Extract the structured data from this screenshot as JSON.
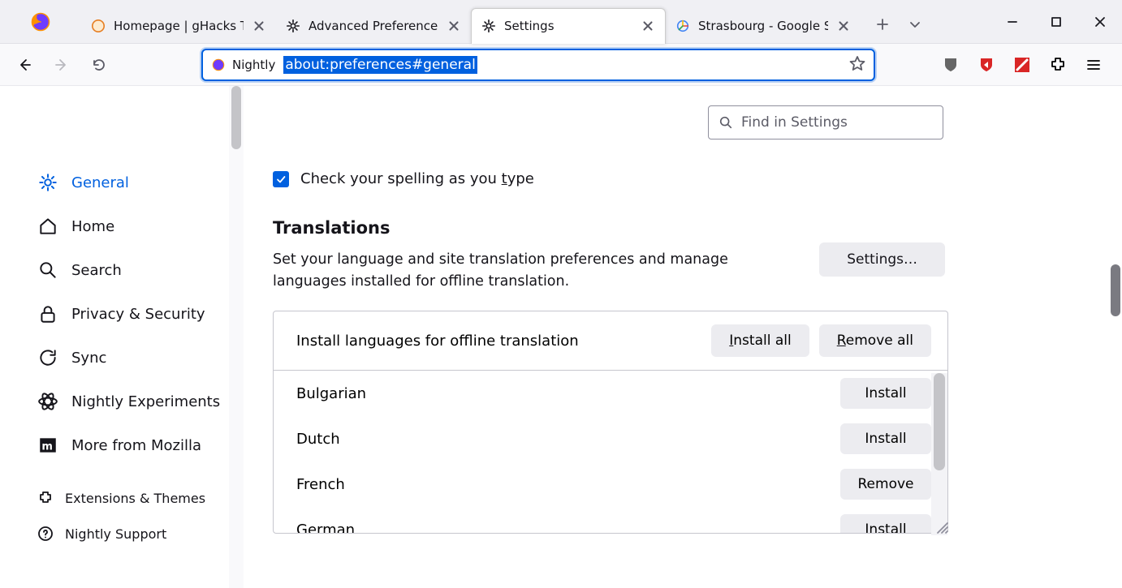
{
  "tabs": [
    {
      "label": "Homepage | gHacks Tech"
    },
    {
      "label": "Advanced Preferences"
    },
    {
      "label": "Settings"
    },
    {
      "label": "Strasbourg - Google Sea"
    }
  ],
  "urlbar": {
    "identity": "Nightly",
    "url": "about:preferences#general"
  },
  "sidebar": {
    "items": [
      {
        "label": "General"
      },
      {
        "label": "Home"
      },
      {
        "label": "Search"
      },
      {
        "label": "Privacy & Security"
      },
      {
        "label": "Sync"
      },
      {
        "label": "Nightly Experiments"
      },
      {
        "label": "More from Mozilla"
      }
    ],
    "small": [
      {
        "label": "Extensions & Themes"
      },
      {
        "label": "Nightly Support"
      }
    ]
  },
  "search_placeholder": "Find in Settings",
  "spellcheck_label": "Check your spelling as you type",
  "translations": {
    "title": "Translations",
    "desc": "Set your language and site translation preferences and manage languages installed for offline translation.",
    "settings_btn": "Settings…",
    "head_label": "Install languages for offline translation",
    "install_all": "Install all",
    "remove_all": "Remove all",
    "install_label": "Install",
    "remove_label": "Remove",
    "languages": [
      {
        "name": "Bulgarian",
        "installed": false
      },
      {
        "name": "Dutch",
        "installed": false
      },
      {
        "name": "French",
        "installed": true
      },
      {
        "name": "German",
        "installed": false
      }
    ]
  }
}
